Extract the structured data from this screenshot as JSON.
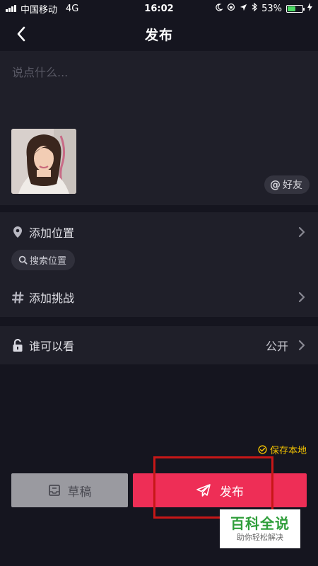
{
  "status_bar": {
    "carrier": "中国移动",
    "network": "4G",
    "time": "16:02",
    "battery_text": "53%",
    "battery_level": 0.53
  },
  "nav": {
    "title": "发布"
  },
  "caption": {
    "placeholder": "说点什么...",
    "value": ""
  },
  "friend_button": {
    "at": "@",
    "label": "好友"
  },
  "location": {
    "label": "添加位置",
    "search_label": "搜索位置"
  },
  "challenge": {
    "hash": "#",
    "label": "添加挑战"
  },
  "privacy": {
    "label": "谁可以看",
    "value": "公开"
  },
  "save_local": {
    "label": "保存本地"
  },
  "actions": {
    "draft_label": "草稿",
    "publish_label": "发布"
  },
  "watermark": {
    "title": "百科全说",
    "subtitle": "助你轻松解决"
  },
  "colors": {
    "background": "#15151f",
    "panel": "#1f1f29",
    "publish": "#ee2e56",
    "draft": "#9a9aa0",
    "save_local": "#f3c300",
    "highlight": "#c71717"
  },
  "icons": {
    "back": "chevron-left-icon",
    "location": "location-pin-icon",
    "search": "search-icon",
    "challenge": "hashtag-icon",
    "privacy": "unlock-icon",
    "draft": "draft-box-icon",
    "publish": "paper-plane-icon",
    "save_local": "check-circle-icon"
  }
}
